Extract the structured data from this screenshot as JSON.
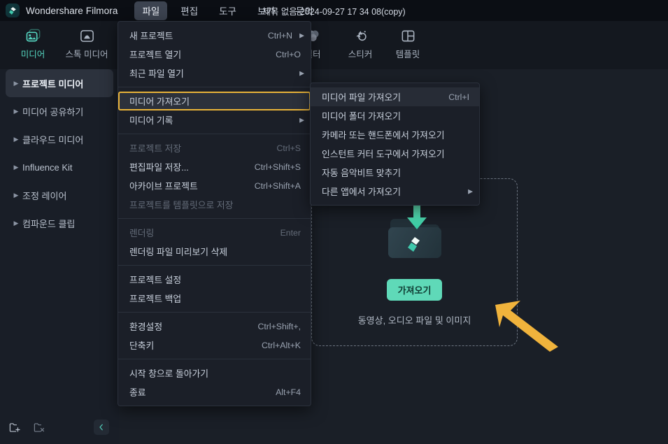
{
  "titlebar": {
    "app_name": "Wondershare Filmora",
    "logo_icon": "filmora-logo-icon",
    "document_title": "제목 없음-2024-09-27 17 34 08(copy)",
    "menus": [
      {
        "label": "파일",
        "active": true
      },
      {
        "label": "편집",
        "active": false
      },
      {
        "label": "도구",
        "active": false
      },
      {
        "label": "보기",
        "active": false
      },
      {
        "label": "문의",
        "active": false
      }
    ]
  },
  "toolbar": {
    "tabs": [
      {
        "label": "미디어",
        "icon": "media-icon",
        "active": true
      },
      {
        "label": "스톡 미디어",
        "icon": "stock-media-icon",
        "active": false
      },
      {
        "label": "필터",
        "icon": "filter-effects-icon",
        "active": false
      },
      {
        "label": "스티커",
        "icon": "sticker-icon",
        "active": false
      },
      {
        "label": "템플릿",
        "icon": "template-icon",
        "active": false
      }
    ]
  },
  "panel_header": {
    "sort_icon": "filter-sort-icon",
    "more_icon": "more-options-icon"
  },
  "sidebar": {
    "items": [
      {
        "label": "프로젝트 미디어",
        "selected": true
      },
      {
        "label": "미디어 공유하기",
        "selected": false
      },
      {
        "label": "클라우드 미디어",
        "selected": false
      },
      {
        "label": "Influence Kit",
        "selected": false
      },
      {
        "label": "조정 레이어",
        "selected": false
      },
      {
        "label": "컴파운드 클립",
        "selected": false
      }
    ],
    "bottom_actions": [
      {
        "icon": "new-folder-icon"
      },
      {
        "icon": "delete-folder-icon"
      },
      {
        "icon": "collapse-panel-icon"
      }
    ]
  },
  "dropzone": {
    "folder_icon": "import-folder-icon",
    "button_label": "가져오기",
    "caption": "동영상, 오디오 파일 및 이미지",
    "annotation_icon": "pointer-arrow-annotation"
  },
  "file_menu": {
    "groups": [
      [
        {
          "label": "새 프로젝트",
          "shortcut": "Ctrl+N",
          "submenu": true,
          "disabled": false
        },
        {
          "label": "프로젝트 열기",
          "shortcut": "Ctrl+O",
          "submenu": false,
          "disabled": false
        },
        {
          "label": "최근 파일 열기",
          "shortcut": "",
          "submenu": true,
          "disabled": false
        }
      ],
      [
        {
          "label": "미디어 가져오기",
          "shortcut": "",
          "submenu": true,
          "disabled": false,
          "boxed": true
        },
        {
          "label": "미디어 기록",
          "shortcut": "",
          "submenu": true,
          "disabled": false
        }
      ],
      [
        {
          "label": "프로젝트 저장",
          "shortcut": "Ctrl+S",
          "submenu": false,
          "disabled": true
        },
        {
          "label": "편집파일 저장...",
          "shortcut": "Ctrl+Shift+S",
          "submenu": false,
          "disabled": false
        },
        {
          "label": "아카이브 프로젝트",
          "shortcut": "Ctrl+Shift+A",
          "submenu": false,
          "disabled": false
        },
        {
          "label": "프로젝트를 템플릿으로 저장",
          "shortcut": "",
          "submenu": false,
          "disabled": true
        }
      ],
      [
        {
          "label": "렌더링",
          "shortcut": "Enter",
          "submenu": false,
          "disabled": true
        },
        {
          "label": "렌더링 파일 미리보기 삭제",
          "shortcut": "",
          "submenu": false,
          "disabled": false
        }
      ],
      [
        {
          "label": "프로젝트 설정",
          "shortcut": "",
          "submenu": false,
          "disabled": false
        },
        {
          "label": "프로젝트 백업",
          "shortcut": "",
          "submenu": false,
          "disabled": false
        }
      ],
      [
        {
          "label": "환경설정",
          "shortcut": "Ctrl+Shift+,",
          "submenu": false,
          "disabled": false
        },
        {
          "label": "단축키",
          "shortcut": "Ctrl+Alt+K",
          "submenu": false,
          "disabled": false
        }
      ],
      [
        {
          "label": "시작 창으로 돌아가기",
          "shortcut": "",
          "submenu": false,
          "disabled": false
        },
        {
          "label": "종료",
          "shortcut": "Alt+F4",
          "submenu": false,
          "disabled": false
        }
      ]
    ]
  },
  "import_submenu": {
    "items": [
      {
        "label": "미디어 파일 가져오기",
        "shortcut": "Ctrl+I",
        "submenu": false,
        "highlighted": true
      },
      {
        "label": "미디어 폴더 가져오기",
        "shortcut": "",
        "submenu": false,
        "highlighted": false
      },
      {
        "label": "카메라 또는 핸드폰에서 가져오기",
        "shortcut": "",
        "submenu": false,
        "highlighted": false
      },
      {
        "label": "인스턴트 커터 도구에서 가져오기",
        "shortcut": "",
        "submenu": false,
        "highlighted": false
      },
      {
        "label": "자동 음악비트 맞추기",
        "shortcut": "",
        "submenu": false,
        "highlighted": false
      },
      {
        "label": "다른 앱에서 가져오기",
        "shortcut": "",
        "submenu": true,
        "highlighted": false
      }
    ]
  },
  "colors": {
    "accent_teal": "#5fd9b8",
    "highlight_gold": "#e8b339",
    "annotation_arrow": "#f0b33c",
    "window_bg": "#14181f",
    "menu_bg": "#1b1f28"
  }
}
